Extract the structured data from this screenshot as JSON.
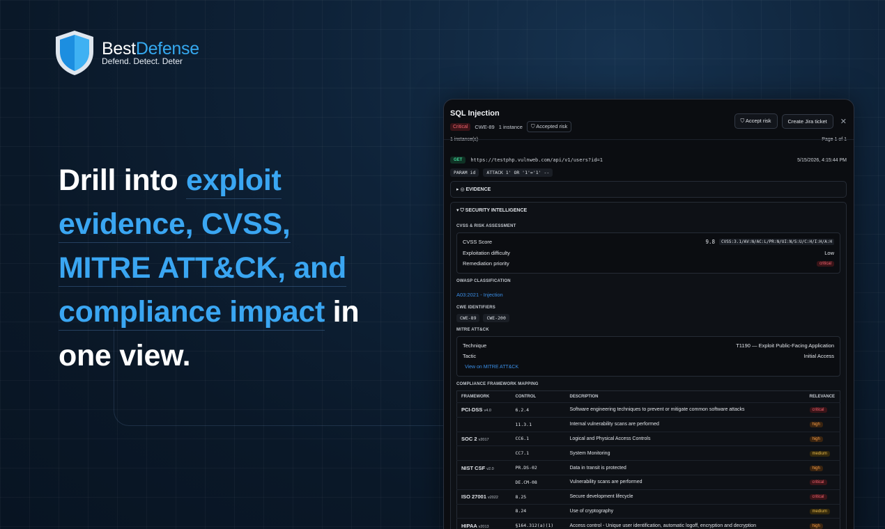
{
  "brand": {
    "name_part1": "Best",
    "name_part2": "Defense",
    "tagline": "Defend. Detect. Deter"
  },
  "headline": {
    "part1": "Drill into ",
    "hl1": "exploit",
    "hl2": "evidence, CVSS,",
    "hl3": "MITRE ATT&CK, and",
    "hl4": "compliance impact",
    "part2": " in",
    "part3": "one view."
  },
  "panel": {
    "title": "SQL Injection",
    "severity": "Critical",
    "cwe": "CWE-89",
    "instances_count": "1 instance",
    "accepted_label": "Accepted risk",
    "accept_button": "Accept risk",
    "jira_button": "Create Jira ticket",
    "close": "✕",
    "instances_label": "1 instance(s)",
    "page_label": "Page 1 of 1",
    "request": {
      "method": "GET",
      "url": "https://testphp.vulnweb.com/api/v1/users?id=1",
      "timestamp": "5/15/2026, 4:15:44 PM",
      "param_chip": "PARAM id",
      "attack_chip": "ATTACK 1' OR '1'='1' --"
    },
    "evidence_label": "▸ ◎ EVIDENCE",
    "intel_label": "▾ ⛉ SECURITY INTELLIGENCE",
    "cvss": {
      "section": "CVSS & RISK ASSESSMENT",
      "score_label": "CVSS Score",
      "score": "9.8",
      "vector": "CVSS:3.1/AV:N/AC:L/PR:N/UI:N/S:U/C:H/I:H/A:H",
      "difficulty_label": "Exploitation difficulty",
      "difficulty": "Low",
      "priority_label": "Remediation priority",
      "priority": "critical"
    },
    "owasp": {
      "section": "OWASP CLASSIFICATION",
      "value": "A03:2021 - Injection"
    },
    "cwe_ids": {
      "section": "CWE IDENTIFIERS",
      "items": [
        "CWE-89",
        "CWE-200"
      ]
    },
    "mitre": {
      "section": "MITRE ATT&CK",
      "technique_label": "Technique",
      "technique": "T1190 — Exploit Public-Facing Application",
      "tactic_label": "Tactic",
      "tactic": "Initial Access",
      "link": "View on MITRE ATT&CK"
    },
    "compliance": {
      "section": "COMPLIANCE FRAMEWORK MAPPING",
      "headers": [
        "FRAMEWORK",
        "CONTROL",
        "DESCRIPTION",
        "RELEVANCE"
      ],
      "rows": [
        {
          "fw": "PCI-DSS",
          "ver": "v4.0",
          "control": "6.2.4",
          "desc": "Software engineering techniques to prevent or mitigate common software attacks",
          "rel": "critical"
        },
        {
          "fw": "",
          "ver": "",
          "control": "11.3.1",
          "desc": "Internal vulnerability scans are performed",
          "rel": "high"
        },
        {
          "fw": "SOC 2",
          "ver": "v2017",
          "control": "CC6.1",
          "desc": "Logical and Physical Access Controls",
          "rel": "high"
        },
        {
          "fw": "",
          "ver": "",
          "control": "CC7.1",
          "desc": "System Monitoring",
          "rel": "medium"
        },
        {
          "fw": "NIST CSF",
          "ver": "v2.0",
          "control": "PR.DS-02",
          "desc": "Data in transit is protected",
          "rel": "high"
        },
        {
          "fw": "",
          "ver": "",
          "control": "DE.CM-08",
          "desc": "Vulnerability scans are performed",
          "rel": "critical"
        },
        {
          "fw": "ISO 27001",
          "ver": "v2022",
          "control": "8.25",
          "desc": "Secure development lifecycle",
          "rel": "critical"
        },
        {
          "fw": "",
          "ver": "",
          "control": "8.24",
          "desc": "Use of cryptography",
          "rel": "medium"
        },
        {
          "fw": "HIPAA",
          "ver": "v2013",
          "control": "§164.312(a)(1)",
          "desc": "Access control - Unique user identification, automatic logoff, encryption and decryption",
          "rel": "high"
        }
      ]
    }
  },
  "colors": {
    "accent": "#3aa6f2",
    "critical": "#f0616d",
    "high": "#f29a46",
    "medium": "#e6b84a"
  }
}
